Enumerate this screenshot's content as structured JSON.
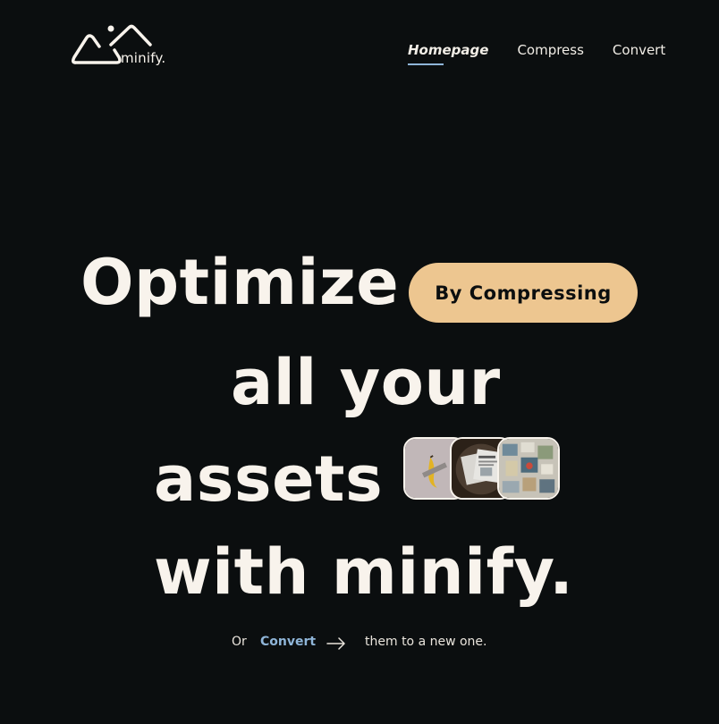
{
  "brand": {
    "name": "minify.",
    "logo_icon": "mountain-logo-icon"
  },
  "nav": {
    "items": [
      {
        "label": "Homepage",
        "active": true
      },
      {
        "label": "Compress",
        "active": false
      },
      {
        "label": "Convert",
        "active": false
      }
    ]
  },
  "hero": {
    "line1": "Optimize",
    "badge": "By Compressing",
    "line2": "all your",
    "line3": "assets",
    "line4": "with minify.",
    "images": [
      "banana-artwork-image",
      "newspaper-image",
      "collage-image"
    ]
  },
  "cta": {
    "prefix": "Or",
    "link": "Convert",
    "arrow_icon": "arrow-right-icon",
    "suffix": "them to a new one."
  },
  "colors": {
    "background": "#0b0e0f",
    "text": "#f8f3ec",
    "accent": "#edc690",
    "link": "#8fb5d8"
  }
}
